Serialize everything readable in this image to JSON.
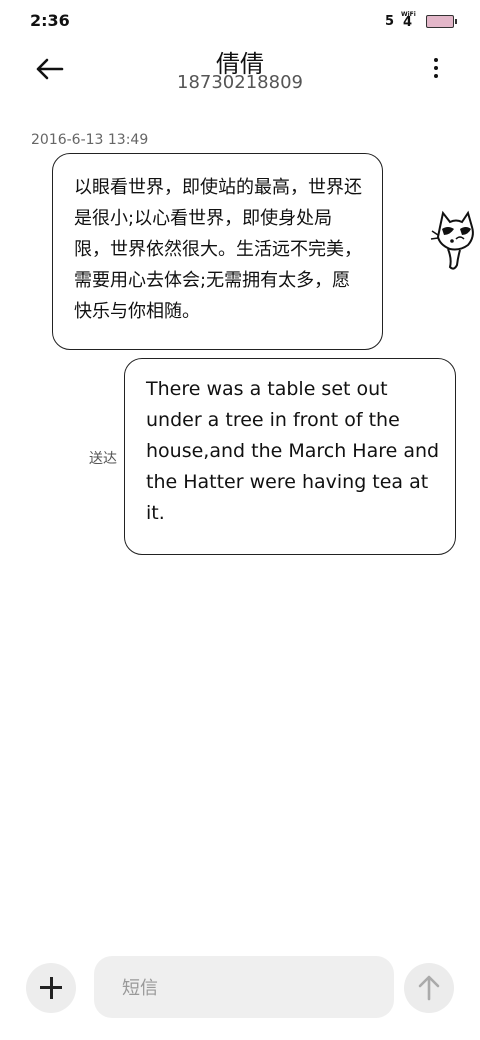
{
  "status_bar": {
    "time": "2:36",
    "signal": "5",
    "wifi_label": "WiFi",
    "wifi_value": "4",
    "battery_color": "#e3b7c9"
  },
  "header": {
    "contact_name": "倩倩",
    "phone_number": "18730218809",
    "back_icon": "arrow-left-icon",
    "menu_icon": "more-vertical-icon"
  },
  "conversation": {
    "timestamp": "2016-6-13 13:49",
    "messages": [
      {
        "direction": "incoming",
        "text": "以眼看世界，即使站的最高，世界还是很小;以心看世界，即使身处局限，世界依然很大。生活远不完美，需要用心去体会;无需拥有太多，愿快乐与你相随。"
      },
      {
        "direction": "outgoing",
        "text": "There was a table set out under a tree in front of the house,and the March Hare and the Hatter were having tea at it.",
        "status": "送达"
      }
    ]
  },
  "composer": {
    "placeholder": "短信",
    "add_icon": "plus-icon",
    "send_icon": "arrow-up-icon"
  }
}
